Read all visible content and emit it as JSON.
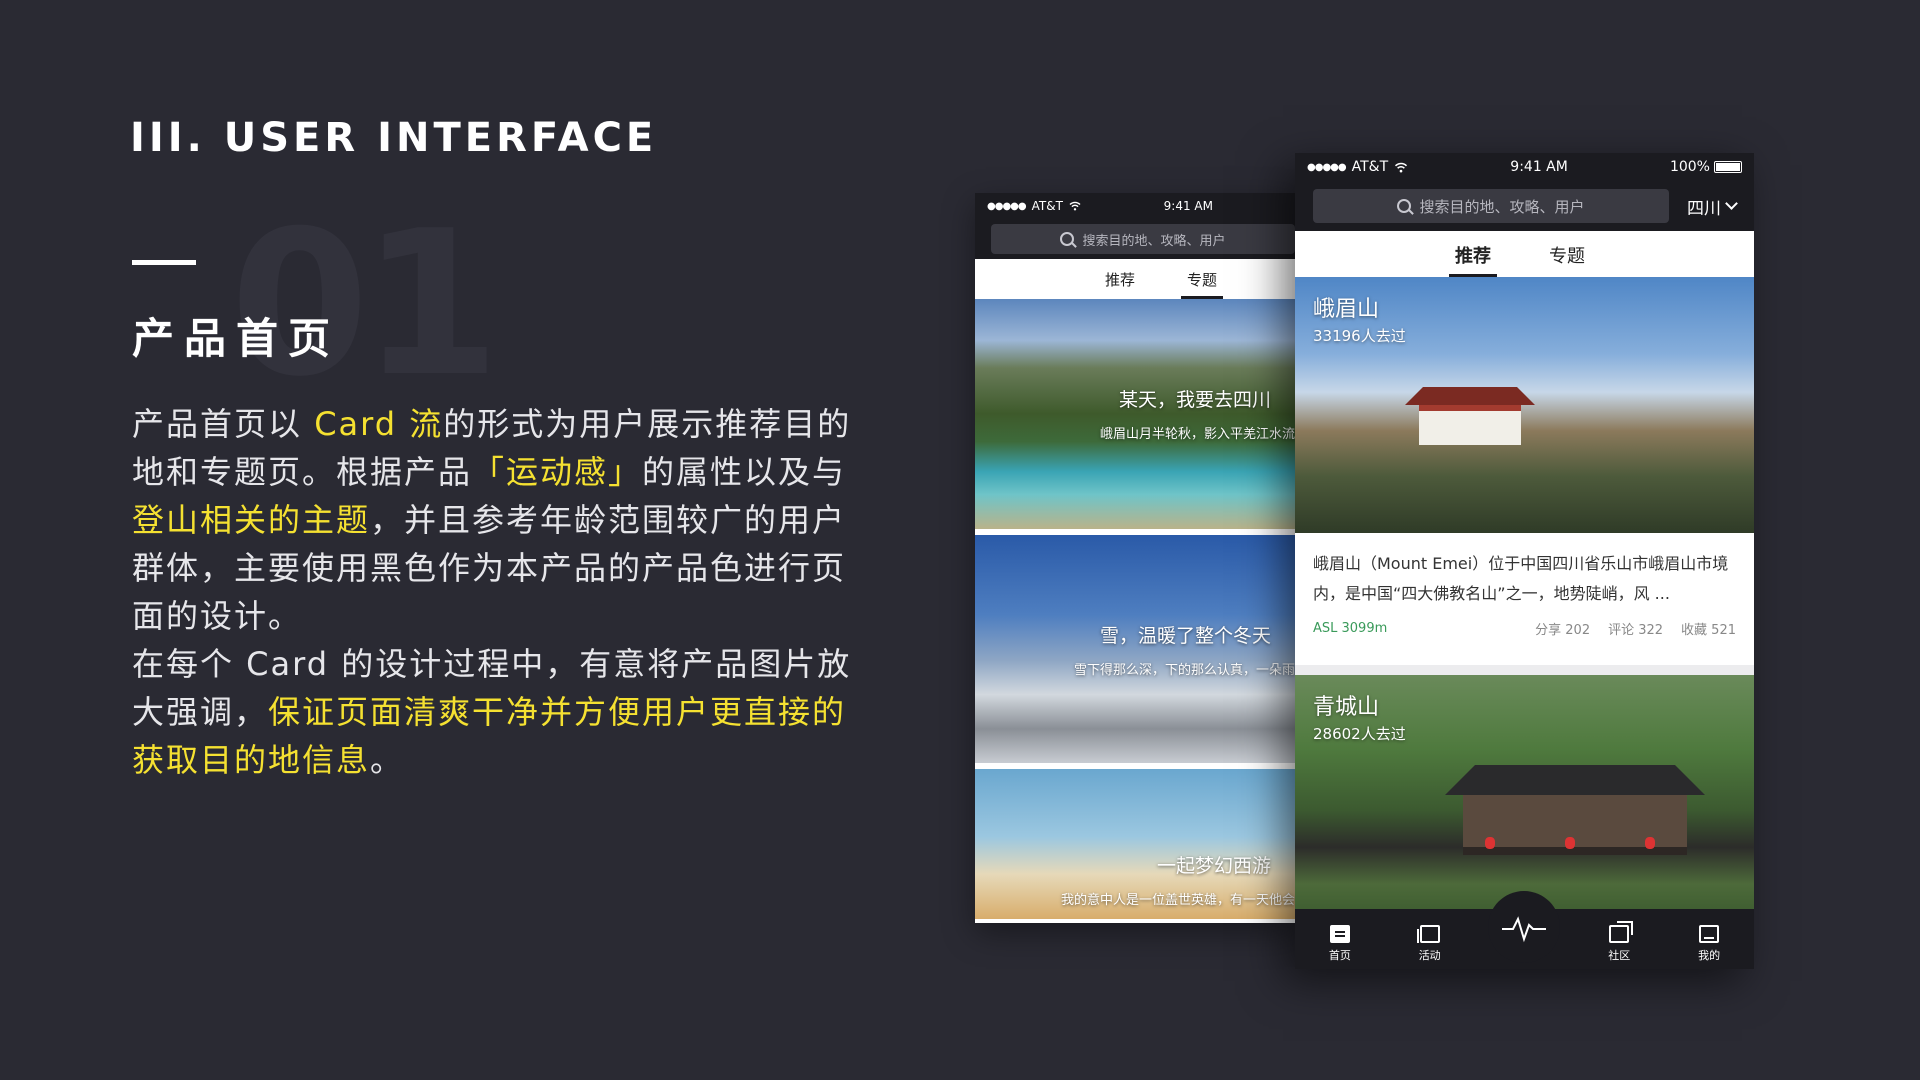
{
  "slide": {
    "section_title": "III. USER INTERFACE",
    "bg_number": "01",
    "heading": "产品首页",
    "desc": [
      {
        "t": "产品首页以 ",
        "hl": false
      },
      {
        "t": "Card 流",
        "hl": true
      },
      {
        "t": "的形式为用户展示推荐目的地和专题页。根据产品",
        "hl": false
      },
      {
        "t": "「运动感」",
        "hl": true
      },
      {
        "t": "的属性以及与",
        "hl": false
      },
      {
        "t": "登山相关的主题",
        "hl": true
      },
      {
        "t": "，并且参考年龄范围较广的用户群体，主要使用黑色作为本产品的产品色进行页面的设计。",
        "hl": false
      },
      {
        "br": true
      },
      {
        "t": "在每个 Card 的设计过程中，有意将产品图片放大强调，",
        "hl": false
      },
      {
        "t": "保证页面清爽干净并方便用户更直接的获取目的地信息",
        "hl": true
      },
      {
        "t": "。",
        "hl": false
      }
    ]
  },
  "status": {
    "carrier": "AT&T",
    "time": "9:41 AM",
    "battery": "100%"
  },
  "search": {
    "placeholder": "搜索目的地、攻略、用户",
    "region": "四川"
  },
  "tabs": {
    "recommend": "推荐",
    "topic": "专题"
  },
  "topics": [
    {
      "title": "某天，我要去四川",
      "subtitle": "峨眉山月半轮秋，影入平羌江水流"
    },
    {
      "title": "雪，温暖了整个冬天",
      "subtitle": "雪下得那么深，下的那么认真，一朵雨"
    },
    {
      "title": "一起梦幻西游",
      "subtitle": "我的意中人是一位盖世英雄，有一天他会"
    }
  ],
  "destinations": [
    {
      "name": "峨眉山",
      "visits": "33196人去过",
      "desc": "峨眉山（Mount Emei）位于中国四川省乐山市峨眉山市境内，是中国“四大佛教名山”之一，地势陡峭，风 ...",
      "asl": "ASL 3099m",
      "share": "分享 202",
      "comment": "评论 322",
      "fav": "收藏 521"
    },
    {
      "name": "青城山",
      "visits": "28602人去过"
    }
  ],
  "tabbar": {
    "home": "首页",
    "activity": "活动",
    "community": "社区",
    "mine": "我的"
  },
  "colors": {
    "background": "#2a2a33",
    "highlight": "#f5e131",
    "product": "#1b1b20",
    "asl": "#3a9a5a"
  }
}
